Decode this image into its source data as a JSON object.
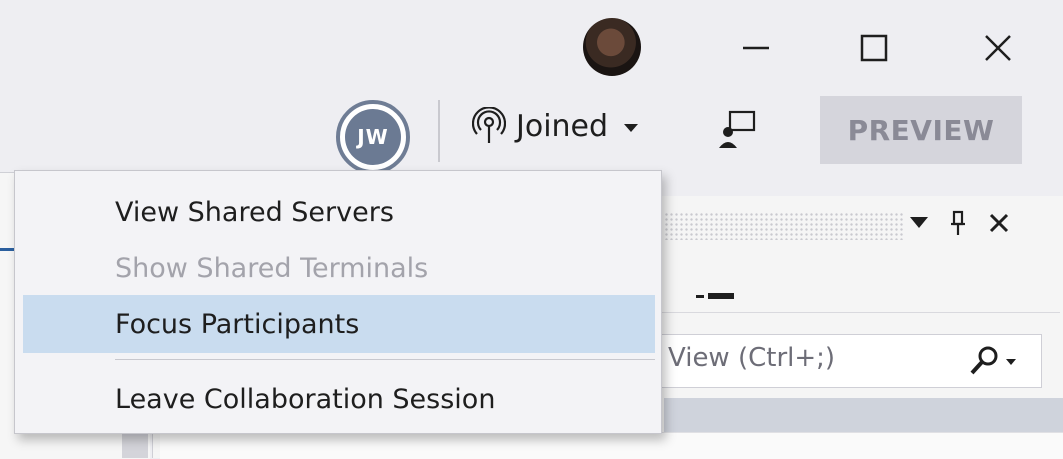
{
  "titlebar": {
    "window_controls": [
      "minimize",
      "maximize",
      "close"
    ]
  },
  "toolbar": {
    "user_initials": "JW",
    "collab_status": "Joined",
    "preview_label": "PREVIEW"
  },
  "menu": {
    "items": [
      {
        "label": "View Shared Servers",
        "enabled": true
      },
      {
        "label": "Show Shared Terminals",
        "enabled": false
      },
      {
        "label": "Focus Participants",
        "enabled": true,
        "highlighted": true
      },
      {
        "label": "Leave Collaboration Session",
        "enabled": true
      }
    ]
  },
  "panel": {
    "search_placeholder": "View (Ctrl+;)"
  },
  "colors": {
    "highlight": "#c9dcef",
    "disabled_text": "#a3a3ab",
    "avatar_ring": "#6f7d95",
    "preview_bg": "#d5d5dc"
  },
  "icons": [
    "user-photo-avatar",
    "minimize-icon",
    "maximize-icon",
    "close-icon",
    "live-share-broadcast-icon",
    "chevron-down-icon",
    "feedback-icon",
    "dropdown-arrow-icon",
    "pin-icon",
    "search-icon"
  ]
}
